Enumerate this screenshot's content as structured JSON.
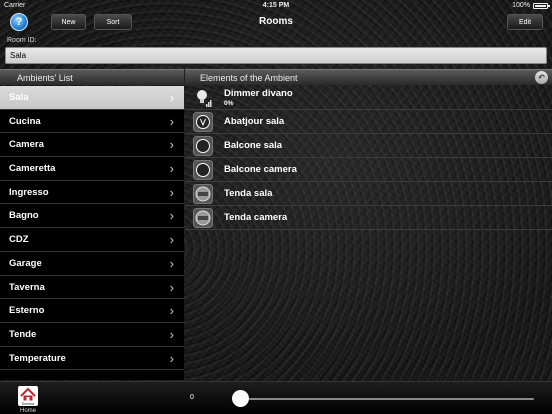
{
  "status_bar": {
    "carrier": "Carrier",
    "time": "4:15 PM",
    "battery": "100%"
  },
  "nav": {
    "title": "Rooms",
    "help_label": "?",
    "new_label": "New",
    "sort_label": "Sort",
    "edit_label": "Edit"
  },
  "room_id": {
    "label": "Room ID:",
    "value": "Sala"
  },
  "headers": {
    "ambients": "Ambients' List",
    "elements": "Elements of the Ambient"
  },
  "ambients": [
    {
      "label": "Sala",
      "selected": true
    },
    {
      "label": "Cucina"
    },
    {
      "label": "Camera"
    },
    {
      "label": "Cameretta"
    },
    {
      "label": "Ingresso"
    },
    {
      "label": "Bagno"
    },
    {
      "label": "CDZ"
    },
    {
      "label": "Garage"
    },
    {
      "label": "Taverna"
    },
    {
      "label": "Esterno"
    },
    {
      "label": "Tende"
    },
    {
      "label": "Temperature"
    }
  ],
  "elements": [
    {
      "name": "Dimmer divano",
      "sub": "0%",
      "icon": "dimmer-bulb-icon"
    },
    {
      "name": "Abatjour sala",
      "icon": "power-button-icon"
    },
    {
      "name": "Balcone sala",
      "icon": "circle-button-icon"
    },
    {
      "name": "Balcone camera",
      "icon": "circle-button-icon"
    },
    {
      "name": "Tenda sala",
      "icon": "stop-button-icon"
    },
    {
      "name": "Tenda camera",
      "icon": "stop-button-icon"
    }
  ],
  "bottom": {
    "home_label": "Home",
    "home_icon_text": "Domina",
    "slider_value": "0"
  },
  "colors": {
    "help_blue": "#2e86d8",
    "selected_row": "#d0d0d0"
  }
}
